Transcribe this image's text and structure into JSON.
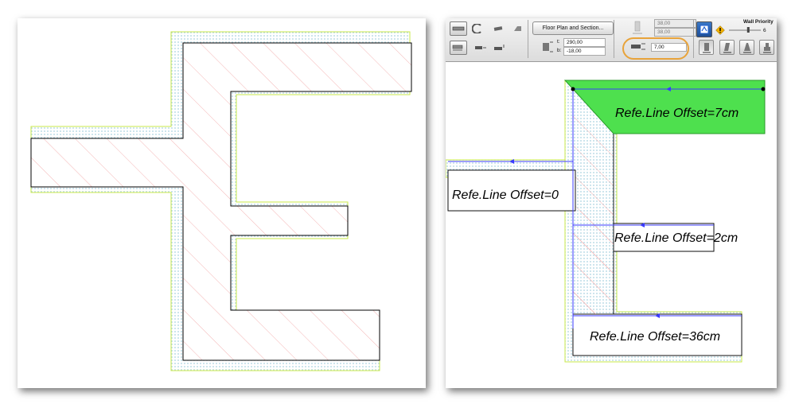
{
  "toolbar": {
    "floor_plan_button": "Floor Plan and Section...",
    "height_top": "38,00",
    "height_bottom": "38,00",
    "top_label": "t:",
    "top_value": "290,00",
    "bottom_label": "b:",
    "bottom_value": "-18,00",
    "reference_offset_value": "7,00",
    "wall_priority_label": "Wall Priority",
    "wall_priority_value": "6",
    "wall_priority_level": 0.6,
    "warning_icon": "exclamation-diamond-icon",
    "colors": {
      "highlight": "#e8a33a",
      "accent": "#1f5fd1"
    }
  },
  "annotations": {
    "offset_7": "Refe.Line Offset=7cm",
    "offset_0": "Refe.Line Offset=0",
    "offset_2": "Refe.Line Offset=2cm",
    "offset_36": "Refe.Line Offset=36cm"
  },
  "colors": {
    "hatch": "#f2a3a3",
    "wall_outline": "#000000",
    "insulation": "#9ec9d8",
    "finish_line": "#c9e84a",
    "reference_line": "#3b3bff",
    "selection": "#4ee04e"
  }
}
